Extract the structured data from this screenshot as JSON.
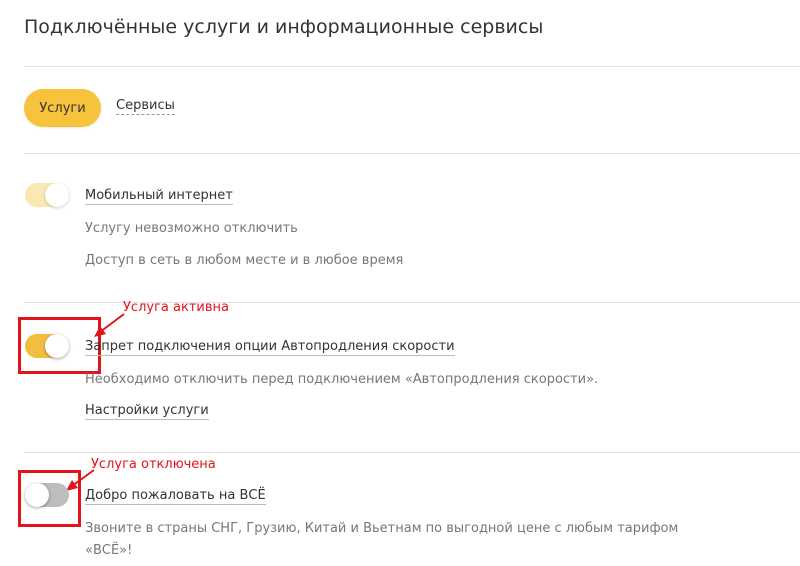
{
  "page": {
    "title": "Подключённые услуги и информационные сервисы"
  },
  "tabs": [
    {
      "label": "Услуги",
      "active": true
    },
    {
      "label": "Сервисы",
      "active": false
    }
  ],
  "services": [
    {
      "title": "Мобильный интернет",
      "state": "on-locked",
      "lines": [
        "Услугу невозможно отключить",
        "Доступ в сеть в любом месте и в любое время"
      ]
    },
    {
      "title": "Запрет подключения опции Автопродления скорости",
      "state": "on",
      "lines": [
        "Необходимо отключить перед подключением «Автопродления скорости»."
      ],
      "link": "Настройки услуги"
    },
    {
      "title": "Добро пожаловать на ВСЁ",
      "state": "off",
      "lines": [
        "Звоните в страны СНГ, Грузию, Китай и Вьетнам по выгодной цене с любым тарифом",
        "«ВСЁ»!"
      ]
    }
  ],
  "annotations": {
    "active": "Услуга активна",
    "inactive": "Услуга отключена"
  },
  "colors": {
    "accent": "#f7c23c",
    "toggle_on": "#f2be40",
    "toggle_locked": "#fbe7b2",
    "toggle_off": "#bdbdbd",
    "annotation": "#e0141a"
  }
}
